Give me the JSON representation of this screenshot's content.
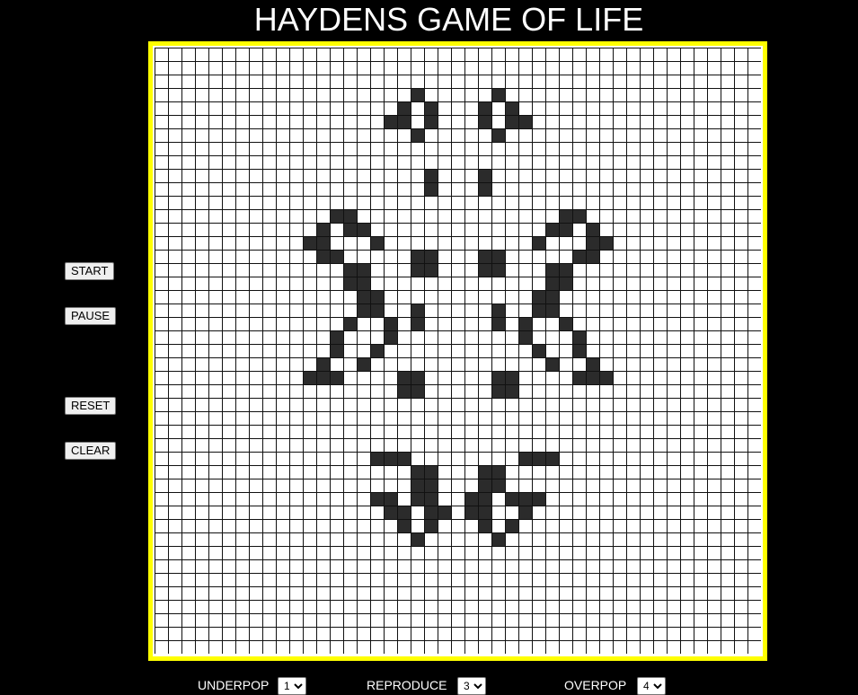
{
  "title": "HAYDENS GAME OF LIFE",
  "controls": {
    "start_label": "START",
    "pause_label": "PAUSE",
    "reset_label": "RESET",
    "clear_label": "CLEAR"
  },
  "board": {
    "columns": 45,
    "rows": 45,
    "alive_color": "#2b2b2b",
    "dead_color": "#ffffff",
    "frame_color": "#ffff00",
    "alive_cells": [
      [
        3,
        19
      ],
      [
        3,
        25
      ],
      [
        4,
        18
      ],
      [
        4,
        20
      ],
      [
        4,
        24
      ],
      [
        4,
        26
      ],
      [
        5,
        17
      ],
      [
        5,
        18
      ],
      [
        5,
        20
      ],
      [
        5,
        24
      ],
      [
        5,
        26
      ],
      [
        5,
        27
      ],
      [
        6,
        19
      ],
      [
        6,
        25
      ],
      [
        9,
        20
      ],
      [
        9,
        24
      ],
      [
        10,
        20
      ],
      [
        10,
        24
      ],
      [
        12,
        13
      ],
      [
        12,
        14
      ],
      [
        12,
        30
      ],
      [
        12,
        31
      ],
      [
        13,
        12
      ],
      [
        13,
        14
      ],
      [
        13,
        15
      ],
      [
        13,
        29
      ],
      [
        13,
        30
      ],
      [
        13,
        32
      ],
      [
        14,
        11
      ],
      [
        14,
        12
      ],
      [
        14,
        16
      ],
      [
        14,
        28
      ],
      [
        14,
        32
      ],
      [
        14,
        33
      ],
      [
        15,
        12
      ],
      [
        15,
        13
      ],
      [
        15,
        19
      ],
      [
        15,
        20
      ],
      [
        15,
        24
      ],
      [
        15,
        25
      ],
      [
        15,
        31
      ],
      [
        15,
        32
      ],
      [
        16,
        14
      ],
      [
        16,
        15
      ],
      [
        16,
        19
      ],
      [
        16,
        20
      ],
      [
        16,
        24
      ],
      [
        16,
        25
      ],
      [
        16,
        29
      ],
      [
        16,
        30
      ],
      [
        17,
        14
      ],
      [
        17,
        15
      ],
      [
        17,
        29
      ],
      [
        17,
        30
      ],
      [
        18,
        15
      ],
      [
        18,
        16
      ],
      [
        18,
        28
      ],
      [
        18,
        29
      ],
      [
        19,
        15
      ],
      [
        19,
        16
      ],
      [
        19,
        19
      ],
      [
        19,
        25
      ],
      [
        19,
        28
      ],
      [
        19,
        29
      ],
      [
        20,
        14
      ],
      [
        20,
        17
      ],
      [
        20,
        19
      ],
      [
        20,
        25
      ],
      [
        20,
        27
      ],
      [
        20,
        30
      ],
      [
        21,
        13
      ],
      [
        21,
        17
      ],
      [
        21,
        27
      ],
      [
        21,
        31
      ],
      [
        22,
        13
      ],
      [
        22,
        16
      ],
      [
        22,
        28
      ],
      [
        22,
        31
      ],
      [
        23,
        12
      ],
      [
        23,
        15
      ],
      [
        23,
        29
      ],
      [
        23,
        32
      ],
      [
        24,
        11
      ],
      [
        24,
        12
      ],
      [
        24,
        13
      ],
      [
        24,
        18
      ],
      [
        24,
        19
      ],
      [
        24,
        25
      ],
      [
        24,
        26
      ],
      [
        24,
        31
      ],
      [
        24,
        32
      ],
      [
        24,
        33
      ],
      [
        25,
        18
      ],
      [
        25,
        19
      ],
      [
        25,
        25
      ],
      [
        25,
        26
      ],
      [
        30,
        16
      ],
      [
        30,
        17
      ],
      [
        30,
        18
      ],
      [
        30,
        27
      ],
      [
        30,
        28
      ],
      [
        30,
        29
      ],
      [
        31,
        19
      ],
      [
        31,
        20
      ],
      [
        31,
        24
      ],
      [
        31,
        25
      ],
      [
        32,
        19
      ],
      [
        32,
        20
      ],
      [
        32,
        24
      ],
      [
        32,
        25
      ],
      [
        33,
        16
      ],
      [
        33,
        17
      ],
      [
        33,
        19
      ],
      [
        33,
        20
      ],
      [
        33,
        23
      ],
      [
        33,
        24
      ],
      [
        33,
        26
      ],
      [
        33,
        27
      ],
      [
        33,
        28
      ],
      [
        34,
        17
      ],
      [
        34,
        18
      ],
      [
        34,
        20
      ],
      [
        34,
        21
      ],
      [
        34,
        23
      ],
      [
        34,
        24
      ],
      [
        34,
        27
      ],
      [
        35,
        18
      ],
      [
        35,
        20
      ],
      [
        35,
        24
      ],
      [
        35,
        26
      ],
      [
        36,
        19
      ],
      [
        36,
        25
      ]
    ]
  },
  "rules": {
    "underpop_label": "UNDERPOP",
    "underpop_value": "1",
    "reproduce_label": "REPRODUCE",
    "reproduce_value": "3",
    "overpop_label": "OVERPOP",
    "overpop_value": "4"
  }
}
